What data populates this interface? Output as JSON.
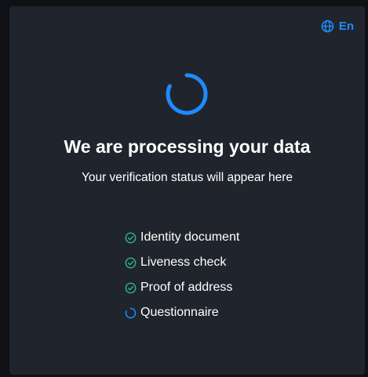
{
  "header": {
    "language_label": "En",
    "language_icon": "globe-icon"
  },
  "status": {
    "spinner_icon": "loading-spinner-icon",
    "title": "We are processing your data",
    "subtitle": "Your verification status will appear here"
  },
  "steps": [
    {
      "label": "Identity document",
      "state": "completed",
      "icon": "check-circle-icon"
    },
    {
      "label": "Liveness check",
      "state": "completed",
      "icon": "check-circle-icon"
    },
    {
      "label": "Proof of address",
      "state": "completed",
      "icon": "check-circle-icon"
    },
    {
      "label": "Questionnaire",
      "state": "in-progress",
      "icon": "loading-spinner-icon"
    }
  ],
  "colors": {
    "background": "#0f1114",
    "card": "#20252d",
    "accent": "#1e8bff",
    "success": "#2bb98a",
    "text": "#ffffff"
  }
}
